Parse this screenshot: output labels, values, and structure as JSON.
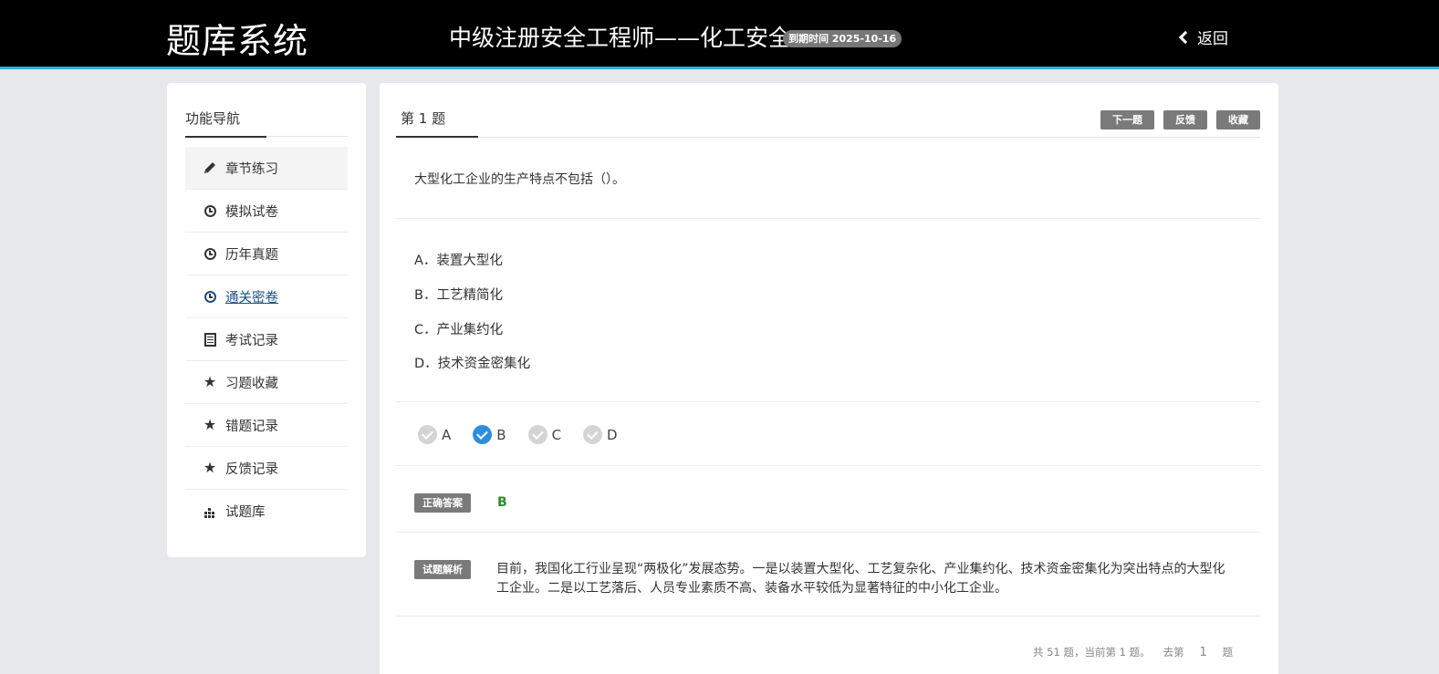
{
  "header": {
    "logo": "题库系统",
    "exam_title": "中级注册安全工程师——化工安全",
    "expire_badge": "到期时间 2025-10-16",
    "back_label": "返回"
  },
  "sidebar": {
    "title": "功能导航",
    "items": [
      {
        "label": "章节练习",
        "icon": "pencil-icon"
      },
      {
        "label": "模拟试卷",
        "icon": "clock-icon"
      },
      {
        "label": "历年真题",
        "icon": "clock-icon"
      },
      {
        "label": "通关密卷",
        "icon": "clock-icon"
      },
      {
        "label": "考试记录",
        "icon": "document-icon"
      },
      {
        "label": "习题收藏",
        "icon": "star-icon"
      },
      {
        "label": "错题记录",
        "icon": "star-icon"
      },
      {
        "label": "反馈记录",
        "icon": "star-icon"
      },
      {
        "label": "试题库",
        "icon": "bar-chart-icon"
      }
    ]
  },
  "question": {
    "title": "第 1 题",
    "buttons": {
      "next": "下一题",
      "feedback": "反馈",
      "favorite": "收藏"
    },
    "text": "大型化工企业的生产特点不包括（）。",
    "options": [
      "A．装置大型化",
      "B．工艺精简化",
      "C．产业集约化",
      "D．技术资金密集化"
    ],
    "choices": [
      "A",
      "B",
      "C",
      "D"
    ],
    "selected": "B",
    "correct_label": "正确答案",
    "correct_value": "B",
    "analysis_label": "试题解析",
    "analysis_text": "目前，我国化工行业呈现“两极化”发展态势。一是以装置大型化、工艺复杂化、产业集约化、技术资金密集化为突出特点的大型化工企业。二是以工艺落后、人员专业素质不高、装备水平较低为显著特征的中小化工企业。"
  },
  "pager": {
    "summary": "共 51 题，当前第 1 题。",
    "goto_prefix": "去第",
    "goto_value": "1",
    "goto_suffix": "题"
  },
  "colors": {
    "header_bg": "#000000",
    "header_accent": "#2bb4d9",
    "selected_radio": "#2b8fe0",
    "correct_answer": "#2e8b2e",
    "link": "#1c4f87"
  }
}
